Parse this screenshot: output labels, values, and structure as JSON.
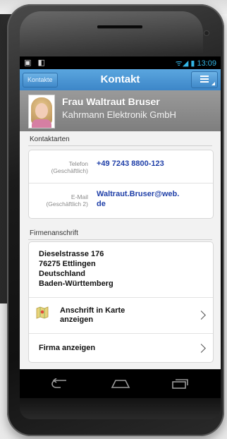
{
  "statusbar": {
    "left_icons": "▣ ◧",
    "signal": "ᯤ◢ ▮",
    "time": "13:09"
  },
  "actionbar": {
    "back_label": "Kontakte",
    "title": "Kontakt"
  },
  "contact": {
    "name": "Frau Waltraut Bruser",
    "company": "Kahrmann Elektronik GmbH"
  },
  "contact_types": {
    "label": "Kontaktarten",
    "rows": [
      {
        "key_line1": "Telefon",
        "key_line2": "(Geschäftlich)",
        "value": "+49 7243 8800-123"
      },
      {
        "key_line1": "E-Mail",
        "key_line2": "(Geschäftlich 2)",
        "value_line1": "Waltraut.Bruser@web.",
        "value_line2": "de"
      }
    ]
  },
  "company_address": {
    "label": "Firmenanschrift",
    "lines": [
      "Dieselstrasse 176",
      "76275 Ettlingen",
      "Deutschland",
      "Baden-Württemberg"
    ],
    "map_link_line1": "Anschrift in Karte",
    "map_link_line2": "anzeigen",
    "company_link": "Firma anzeigen"
  },
  "icons": {
    "back": "back-arrow-icon",
    "home": "home-icon",
    "recent": "recent-apps-icon",
    "menu": "overflow-menu-icon",
    "map": "map-icon"
  },
  "colors": {
    "accent": "#3d86c8",
    "link": "#1f3fa8",
    "status": "#33b5e5"
  }
}
